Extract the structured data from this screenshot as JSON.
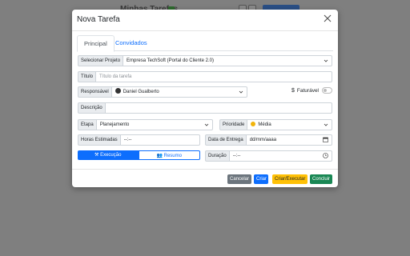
{
  "background": {
    "title": "Minhas Tarefas"
  },
  "modal": {
    "title": "Nova Tarefa",
    "tabs": [
      "Principal",
      "Convidados"
    ],
    "fields": {
      "project": {
        "label": "Selecionar Projeto",
        "value": "Empresa TechSoft (Portal do Cliente 2.0)"
      },
      "title": {
        "label": "Título",
        "placeholder": "Título da tarefa"
      },
      "responsible": {
        "label": "Responsável",
        "value": "Daniel Gualberto"
      },
      "billable": {
        "label": "Faturável",
        "symbol": "$"
      },
      "description": {
        "label": "Descrição"
      },
      "stage": {
        "label": "Etapa",
        "value": "Planejamento"
      },
      "priority": {
        "label": "Prioridade",
        "value": "Média"
      },
      "estimated_hours": {
        "label": "Horas Estimadas",
        "value": "--:--"
      },
      "due_date": {
        "label": "Data de Entrega",
        "value": "dd/mm/aaaa"
      },
      "duration": {
        "label": "Duração",
        "value": "--:--"
      }
    },
    "mode": {
      "execution": "Execução",
      "summary": "Resumo"
    },
    "buttons": {
      "cancel": "Cancelar",
      "create": "Criar",
      "create_execute": "Criar/Executar",
      "complete": "Concluir"
    }
  }
}
